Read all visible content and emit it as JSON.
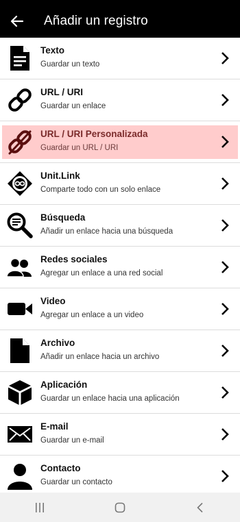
{
  "header": {
    "title": "Añadir un registro",
    "back_icon": "arrow-left-icon"
  },
  "items": [
    {
      "title": "Texto",
      "subtitle": "Guardar un texto",
      "icon": "document-icon"
    },
    {
      "title": "URL / URI",
      "subtitle": "Guardar un enlace",
      "icon": "link-icon"
    },
    {
      "title": "URL / URI Personalizada",
      "subtitle": "Guardar un URL / URI",
      "icon": "custom-link-icon",
      "highlighted": true,
      "highlight_color": "#ffcccc",
      "icon_color": "#5a0f0f"
    },
    {
      "title": "Unit.Link",
      "subtitle": "Comparte todo con un solo enlace",
      "icon": "unit-link-logo-icon"
    },
    {
      "title": "Búsqueda",
      "subtitle": "Añadir un enlace hacia una búsqueda",
      "icon": "search-icon"
    },
    {
      "title": "Redes sociales",
      "subtitle": "Agregar un enlace a una red social",
      "icon": "people-icon"
    },
    {
      "title": "Video",
      "subtitle": "Agregar un enlace a un video",
      "icon": "video-camera-icon"
    },
    {
      "title": "Archivo",
      "subtitle": "Añadir un enlace hacia un archivo",
      "icon": "file-icon"
    },
    {
      "title": "Aplicación",
      "subtitle": "Guardar un enlace hacia una aplicación",
      "icon": "cube-icon"
    },
    {
      "title": "E-mail",
      "subtitle": "Guardar un e-mail",
      "icon": "envelope-icon"
    },
    {
      "title": "Contacto",
      "subtitle": "Guardar un contacto",
      "icon": "person-icon"
    }
  ],
  "navbar": {
    "recent_icon": "recent-apps-icon",
    "home_icon": "home-icon",
    "back_icon": "back-chevron-icon"
  },
  "colors": {
    "appbar": "#000000",
    "navbar": "#f1f1f1",
    "divider": "#dcdcdc"
  }
}
